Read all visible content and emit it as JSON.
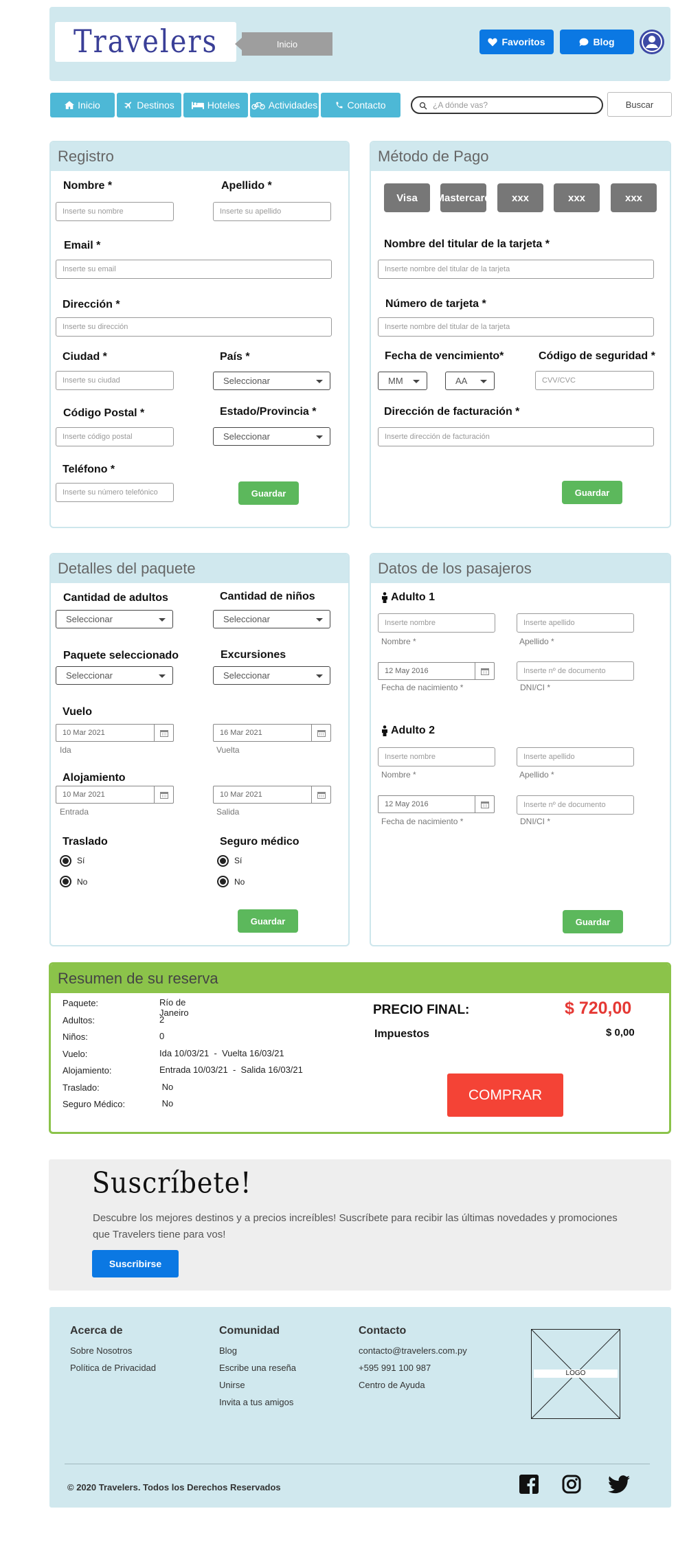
{
  "header": {
    "logo": "Travelers",
    "inicio_tag": "Inicio",
    "favoritos": "Favoritos",
    "blog": "Blog"
  },
  "nav": {
    "items": [
      "Inicio",
      "Destinos",
      "Hoteles",
      "Actividades",
      "Contacto"
    ],
    "search_placeholder": "¿A dónde vas?",
    "search_button": "Buscar"
  },
  "registro": {
    "title": "Registro",
    "nombre_label": "Nombre *",
    "nombre_ph": "Inserte su nombre",
    "apellido_label": "Apellido *",
    "apellido_ph": "Inserte su apellido",
    "email_label": "Email *",
    "email_ph": "Inserte su email",
    "direccion_label": "Dirección *",
    "direccion_ph": "Inserte su dirección",
    "ciudad_label": "Ciudad *",
    "ciudad_ph": "Inserte su ciudad",
    "pais_label": "País *",
    "pais_value": "Seleccionar",
    "cp_label": "Código Postal *",
    "cp_ph": "Inserte código postal",
    "estado_label": "Estado/Provincia *",
    "estado_value": "Seleccionar",
    "telefono_label": "Teléfono *",
    "telefono_ph": "Inserte su número telefónico",
    "guardar": "Guardar"
  },
  "pago": {
    "title": "Método de Pago",
    "cards": [
      "Visa",
      "Mastercard",
      "xxx",
      "xxx",
      "xxx"
    ],
    "titular_label": "Nombre del titular de la tarjeta *",
    "titular_ph": "Inserte nombre del titular de la tarjeta",
    "numero_label": "Número de tarjeta *",
    "numero_ph": "Inserte nombre del titular de la tarjeta",
    "venc_label": "Fecha de vencimiento*",
    "mes_value": "MM",
    "anio_value": "AA",
    "cvv_label": "Código de seguridad *",
    "cvv_ph": "CVV/CVC",
    "facturacion_label": "Dirección de facturación *",
    "facturacion_ph": "Inserte dirección de facturación",
    "guardar": "Guardar"
  },
  "paquete": {
    "title": "Detalles del paquete",
    "adultos_label": "Cantidad de adultos",
    "adultos_value": "Seleccionar",
    "ninos_label": "Cantidad de niños",
    "ninos_value": "Seleccionar",
    "paquete_label": "Paquete seleccionado",
    "paquete_value": "Seleccionar",
    "excursiones_label": "Excursiones",
    "excursiones_value": "Seleccionar",
    "vuelo_label": "Vuelo",
    "ida_value": "10 Mar 2021",
    "ida_sub": "Ida",
    "vuelta_value": "16 Mar 2021",
    "vuelta_sub": "Vuelta",
    "alojamiento_label": "Alojamiento",
    "entrada_value": "10 Mar 2021",
    "entrada_sub": "Entrada",
    "salida_value": "10 Mar 2021",
    "salida_sub": "Salida",
    "traslado_label": "Traslado",
    "seguro_label": "Seguro médico",
    "si": "Sí",
    "no": "No",
    "guardar": "Guardar"
  },
  "pasajeros": {
    "title": "Datos de los pasajeros",
    "adulto1": "Adulto 1",
    "adulto2": "Adulto 2",
    "nombre_ph": "Inserte nombre",
    "nombre_sub": "Nombre *",
    "apellido_ph": "Inserte apellido",
    "apellido_sub": "Apellido *",
    "fecha_value": "12 May 2016",
    "fecha_sub": "Fecha de nacimiento *",
    "doc_ph": "Inserte nº de documento",
    "doc_sub": "DNI/CI *",
    "guardar": "Guardar"
  },
  "resumen": {
    "title": "Resumen de su reserva",
    "rows": [
      {
        "k": "Paquete:",
        "v": "Río de Janeiro"
      },
      {
        "k": "Adultos:",
        "v": "2"
      },
      {
        "k": "Niños:",
        "v": "0"
      },
      {
        "k": "Vuelo:",
        "v": "Ida 10/03/21  -  Vuelta 16/03/21"
      },
      {
        "k": "Alojamiento:",
        "v": "Entrada 10/03/21  -  Salida 16/03/21"
      },
      {
        "k": "Traslado:",
        "v": " No"
      },
      {
        "k": "Seguro Médico:",
        "v": " No"
      }
    ],
    "precio_label": "PRECIO FINAL:",
    "precio_value": "$ 720,00",
    "impuestos_label": "Impuestos",
    "impuestos_value": "$ 0,00",
    "comprar": "COMPRAR"
  },
  "suscribete": {
    "title": "Suscríbete!",
    "text": "Descubre los mejores destinos y a precios increíbles! Suscríbete para recibir las últimas novedades y promociones que Travelers tiene para vos!",
    "button": "Suscribirse"
  },
  "footer": {
    "acerca_title": "Acerca de",
    "acerca_links": [
      "Sobre Nosotros",
      "Política de Privacidad"
    ],
    "comunidad_title": "Comunidad",
    "comunidad_links": [
      "Blog",
      "Escribe una reseña",
      "Unirse",
      "Invita a tus amigos"
    ],
    "contacto_title": "Contacto",
    "contacto_links": [
      "contacto@travelers.com.py",
      "+595 991 100 987",
      "Centro de Ayuda"
    ],
    "logo": "LOGO",
    "copyright": "© 2020 Travelers. Todos los Derechos Reservados"
  },
  "colors": {
    "brand_blue": "#0b78e3",
    "nav_blue": "#4db8d6",
    "light_panel": "#d0e8ee",
    "save_green": "#5cb85c",
    "summary_green": "#8bc34a",
    "price_red": "#e53935"
  }
}
